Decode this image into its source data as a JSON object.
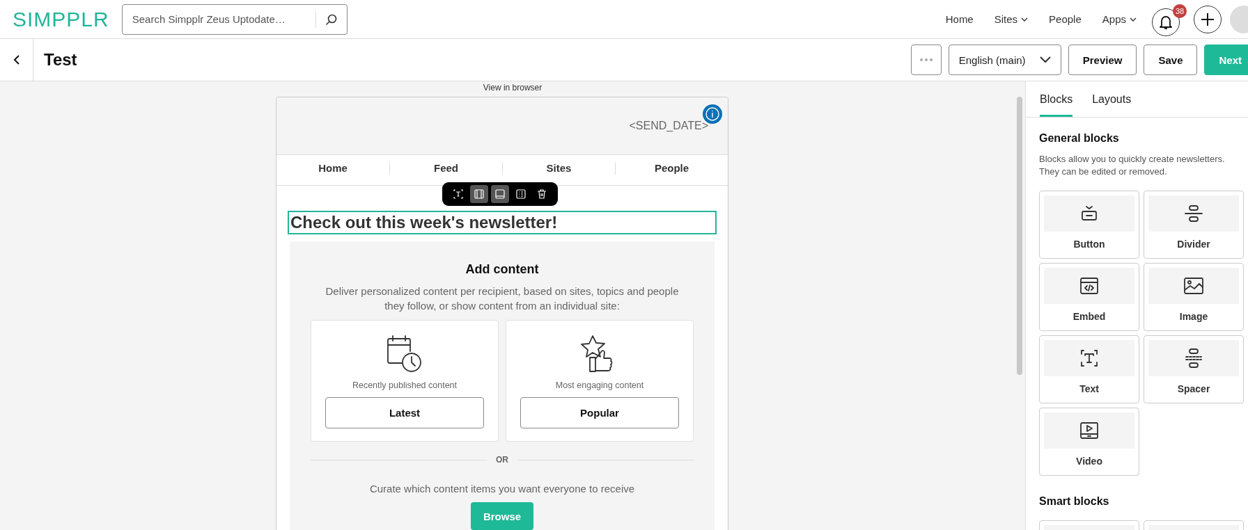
{
  "header": {
    "logo": "SIMPPLR",
    "search": {
      "placeholder": "Search Simpplr Zeus Uptodate…"
    },
    "nav": [
      {
        "label": "Home",
        "has_menu": false
      },
      {
        "label": "Sites",
        "has_menu": true
      },
      {
        "label": "People",
        "has_menu": false
      },
      {
        "label": "Apps",
        "has_menu": true
      }
    ],
    "notifications": {
      "count": "38"
    }
  },
  "editor_bar": {
    "title": "Test",
    "language": "English (main)",
    "buttons": [
      {
        "label": "Preview",
        "kind": "secondary"
      },
      {
        "label": "Save",
        "kind": "secondary"
      },
      {
        "label": "Next",
        "kind": "primary"
      }
    ]
  },
  "email": {
    "view_in_browser": "View in browser",
    "send_date": "<SEND_DATE>",
    "nav": [
      "Home",
      "Feed",
      "Sites",
      "People"
    ],
    "toolbar": [
      {
        "kind": "text",
        "selected": false
      },
      {
        "kind": "columns",
        "selected": true
      },
      {
        "kind": "footer",
        "selected": true
      },
      {
        "kind": "list",
        "selected": false
      },
      {
        "kind": "delete",
        "selected": false
      }
    ],
    "headline": "Check out this week's newsletter!",
    "add_content": {
      "title": "Add content",
      "description": "Deliver personalized content per recipient, based on sites, topics and people they follow, or show content from an individual site:",
      "options": [
        {
          "kind": "calendar",
          "caption": "Recently published content",
          "button": "Latest"
        },
        {
          "kind": "star",
          "caption": "Most engaging content",
          "button": "Popular"
        }
      ],
      "separator": "OR",
      "curate_text": "Curate which content items you want everyone to receive",
      "browse_button": "Browse"
    }
  },
  "panel": {
    "tabs": [
      {
        "label": "Blocks",
        "selected": true
      },
      {
        "label": "Layouts",
        "selected": false
      }
    ],
    "general": {
      "title": "General blocks",
      "description": "Blocks allow you to quickly create newsletters. They can be edited or removed.",
      "blocks": [
        {
          "label": "Button",
          "kind": "button"
        },
        {
          "label": "Divider",
          "kind": "divider"
        },
        {
          "label": "Embed",
          "kind": "embed"
        },
        {
          "label": "Image",
          "kind": "image"
        },
        {
          "label": "Text",
          "kind": "text"
        },
        {
          "label": "Spacer",
          "kind": "spacer"
        },
        {
          "label": "Video",
          "kind": "video"
        }
      ]
    },
    "smart": {
      "title": "Smart blocks"
    }
  }
}
